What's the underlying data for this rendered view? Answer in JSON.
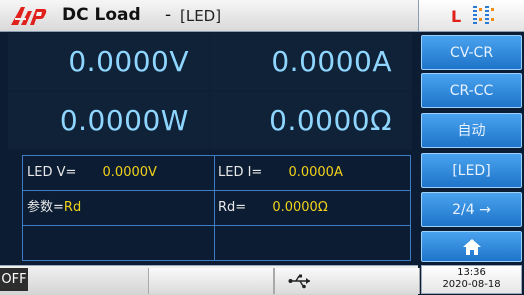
{
  "title": {
    "logo_text": "AHP",
    "app_name": "DC Load",
    "separator": "-",
    "mode": "[LED]"
  },
  "status": {
    "indicator": "L",
    "indicator_color": "#e0201a"
  },
  "readings": {
    "voltage": "0.0000V",
    "current": "0.0000A",
    "power": "0.0000W",
    "resistance": "0.0000Ω"
  },
  "table": {
    "row1": {
      "left_label": "LED V=",
      "left_value": "0.0000V",
      "right_label": "LED I=",
      "right_value": "0.0000A"
    },
    "row2": {
      "left_label": "参数=",
      "left_value": "Rd",
      "right_label": "Rd=",
      "right_value": "0.0000Ω"
    },
    "row3": {
      "left_label": "",
      "left_value": "",
      "right_label": "",
      "right_value": ""
    }
  },
  "side_buttons": {
    "b1": "CV-CR",
    "b2": "CR-CC",
    "b3": "自动",
    "b4": "[LED]",
    "b5": "2/4 →",
    "b6_icon": "home-icon"
  },
  "bottom": {
    "output_state": "OFF",
    "usb_icon": "usb-icon"
  },
  "clock": {
    "time": "13:36",
    "date": "2020-08-18"
  },
  "colors": {
    "reading_color": "#8fd6ff",
    "value_color": "#f2d21a",
    "button_blue": "#2f8ae0"
  }
}
